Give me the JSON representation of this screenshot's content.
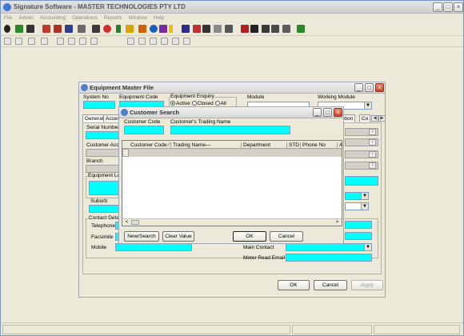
{
  "app": {
    "title": "Signature Software - MASTER TECHNOLOGIES PTY LTD",
    "menu": [
      "File",
      "Admin",
      "Accounting",
      "Operations",
      "Reports",
      "Window",
      "Help"
    ]
  },
  "equipment_window": {
    "title": "Equipment Master File",
    "system_no_label": "System No",
    "equipment_code_label": "Equipment Code",
    "equipment_enquiry_label": "Equipment Enquiry",
    "enquiry_options": [
      "Active",
      "Closed",
      "All"
    ],
    "module_label": "Module",
    "module_value": "",
    "working_module_label": "Working Module",
    "tabs": [
      "General",
      "Acces",
      "ection",
      "Co"
    ],
    "serial_number_label": "Serial Number",
    "customer_account_label": "Customer Accou",
    "branch_label": "Branch",
    "equipment_location_label": "Equipment Loc",
    "suburb_label": "Suburb",
    "contact_details_label": "Contact Detail",
    "telephone_label": "Telephone",
    "facsimile_label": "Facsimile",
    "mobile_label": "Mobile",
    "main_contact_label": "Main Contact",
    "meter_read_email_label": "Meter Read Email",
    "ok_label": "OK",
    "cancel_label": "Cancel",
    "apply_label": "Apply"
  },
  "customer_search": {
    "title": "Customer Search",
    "customer_code_label": "Customer Code",
    "trading_name_label": "Customer's Trading Name",
    "columns": [
      "Customer Code ∕",
      "Trading Name—",
      "Department",
      "STD",
      "Phone No",
      "A"
    ],
    "new_search_label": "New/Search",
    "clear_value_label": "Clear Value",
    "ok_label": "OK",
    "cancel_label": "Cancel"
  },
  "colors": {
    "field": "#00ffff",
    "window_bg": "#ece9d8",
    "close_button": "#c9482c"
  }
}
